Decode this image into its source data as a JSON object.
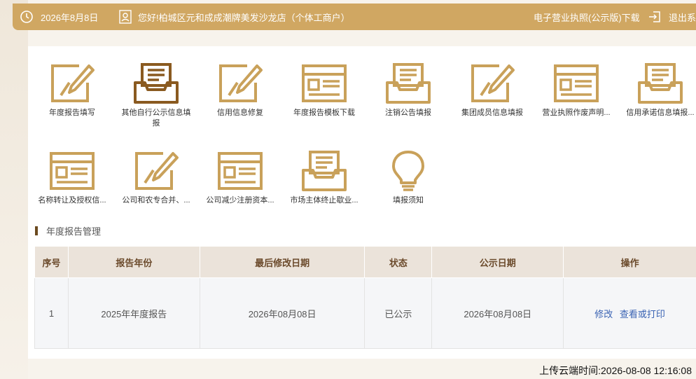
{
  "header": {
    "date": "2026年8月8日",
    "greeting": "您好!柏城区元和成成潮牌美发沙龙店（个体工商户）",
    "license_download": "电子营业执照(公示版)下载",
    "logout": "退出系"
  },
  "tiles": [
    {
      "label": "年度报告填写",
      "icon": "pencil-edit-icon"
    },
    {
      "label": "其他自行公示信息填报",
      "icon": "inbox-tray-icon"
    },
    {
      "label": "信用信息修复",
      "icon": "pencil-edit-icon"
    },
    {
      "label": "年度报告模板下载",
      "icon": "browser-window-icon"
    },
    {
      "label": "注销公告填报",
      "icon": "inbox-tray-icon"
    },
    {
      "label": "集团成员信息填报",
      "icon": "pencil-edit-icon"
    },
    {
      "label": "营业执照作废声明...",
      "icon": "browser-window-icon"
    },
    {
      "label": "信用承诺信息填报...",
      "icon": "inbox-tray-icon"
    },
    {
      "label": "名称转让及授权信...",
      "icon": "browser-window-icon"
    },
    {
      "label": "公司和农专合并、...",
      "icon": "pencil-edit-icon"
    },
    {
      "label": "公司减少注册资本...",
      "icon": "browser-window-icon"
    },
    {
      "label": "市场主体终止歇业...",
      "icon": "inbox-tray-icon"
    },
    {
      "label": "填报须知",
      "icon": "lightbulb-icon"
    }
  ],
  "section": {
    "title": "年度报告管理"
  },
  "table": {
    "headers": [
      "序号",
      "报告年份",
      "最后修改日期",
      "状态",
      "公示日期",
      "操作"
    ],
    "rows": [
      {
        "index": "1",
        "year": "2025年年度报告",
        "modified": "2026年08月08日",
        "status": "已公示",
        "published": "2026年08月08日",
        "actions": [
          "修改",
          "查看或打印"
        ]
      }
    ]
  },
  "footer": {
    "upload_time": "上传云端时间:2026-08-08 12:16:08"
  },
  "colors": {
    "accent": "#d0a762",
    "icon_gold": "#c9a15a",
    "icon_brown": "#8a5a20",
    "link": "#3a63b3"
  }
}
